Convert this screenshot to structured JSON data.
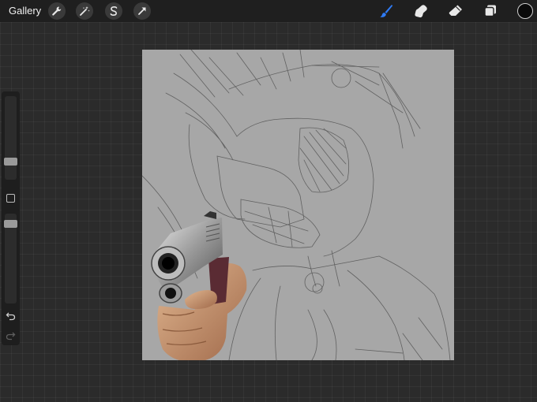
{
  "topbar": {
    "gallery_label": "Gallery",
    "left_tools": [
      "wrench-icon",
      "magic-wand-icon",
      "selection-s-icon",
      "transform-arrow-icon"
    ],
    "right_tools": [
      "brush-icon",
      "smudge-icon",
      "eraser-icon",
      "layers-icon"
    ],
    "active_tool": "brush-icon",
    "accent_color": "#2f7bf5",
    "current_color": "#0a0a0a"
  },
  "sidebar": {
    "brush_size_level": 0.3,
    "opacity_level": 0.95,
    "controls": [
      "modify-button",
      "undo-icon",
      "redo-icon"
    ]
  },
  "canvas": {
    "background_color": "#a7a7a7",
    "content": [
      "pencil-sketch-artwork",
      "pistol-in-hand-image"
    ]
  }
}
